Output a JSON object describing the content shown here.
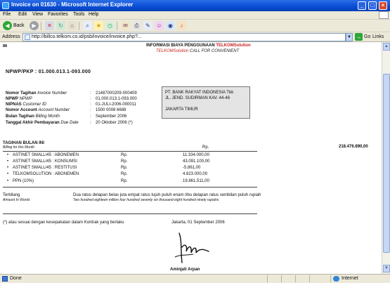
{
  "window": {
    "title": "Invoice on 01630 - Microsoft Internet Explorer",
    "buttons": {
      "minimize": "_",
      "maximize": "□",
      "close": "×"
    }
  },
  "menu": [
    "File",
    "Edit",
    "View",
    "Favorites",
    "Tools",
    "Help"
  ],
  "toolbar": {
    "back_label": "Back"
  },
  "address": {
    "label": "Address",
    "url": "http://billco.telkom.co.id/psb/invoice/invoice.php?...",
    "go_label": "Go",
    "links_label": "Links"
  },
  "header": {
    "line1_prefix": "INFORMASI BIAYA PENGGUNAAN ",
    "line1_brand": "TELKOMSolution",
    "line2_brand": "TELKOMSolution",
    "line2_suffix": " CALL FOR CONVENIENT"
  },
  "npwp": "NPWP/PKP : 01.000.013.1-093.000",
  "info_rows": [
    {
      "label": "Nomor Tagihan",
      "label_en": "Invoice Number",
      "value": "21487000209-000409"
    },
    {
      "label": "NPWP",
      "label_en": "NPWP",
      "value": "01.000.013.1-093.000"
    },
    {
      "label": "NIPNAS",
      "label_en": "Customer ID",
      "value": "01-JULI-2006-000011"
    },
    {
      "label": "Nomor Account",
      "label_en": "Account Number",
      "value": "1500 0008 6688"
    },
    {
      "label": "Bulan Tagihan",
      "label_en": "Billing Month",
      "value": "September 2006"
    },
    {
      "label": "Tanggal Akhir Pembayaran",
      "label_en": "Due Date",
      "value": "20 Oktober 2006 (*)"
    }
  ],
  "address_box": {
    "line1": "PT. BANK RAKYAT INDONESIA Tbk",
    "line2": "JL. JEND. SUDIRMAN KAV. 44-46",
    "line3": "JAKARTA TIMUR"
  },
  "charges": {
    "title": "TAGIHAN BULAN INI",
    "subtitle": "Billing for this Month",
    "currency_label": "Rp.",
    "total": "218.476.890,00",
    "items": [
      {
        "name": "ASTINET SMALL/45 : ABONEMEN",
        "currency": "Rp.",
        "amount": "11.334.000,00"
      },
      {
        "name": "ASTINET SMALL/45 : KONSUMSI",
        "currency": "Rp.",
        "amount": "43.091.100,00"
      },
      {
        "name": "ASTINET SMALL/45 : RESTITUSI",
        "currency": "Rp.",
        "amount": "-5.861,00"
      },
      {
        "name": "TELKOMSOLUTION : ABONEMEN",
        "currency": "Rp.",
        "amount": "4.823.000,00"
      },
      {
        "name": "PPN (10%)",
        "currency": "Rp.",
        "amount": "19.861.511,00"
      }
    ]
  },
  "terbilang": {
    "label": "Terbilang",
    "label_en": "Amount In Words",
    "text": "Dua ratus delapan belas juta empat ratus tujuh puluh enam ribu delapan ratus sembilan puluh rupiah",
    "text_en": "Two hundred eighteen million four hundred seventy six thousand eight hundred ninety rupiahs"
  },
  "closing": "(*) atau sesuai dengan kesepakatan dalam Kontrak yang berlaku",
  "city_date": "Jakarta, 01 September 2006",
  "signer": "Aminjati Arpan",
  "status": {
    "done": "Done",
    "zone": "Internet"
  }
}
